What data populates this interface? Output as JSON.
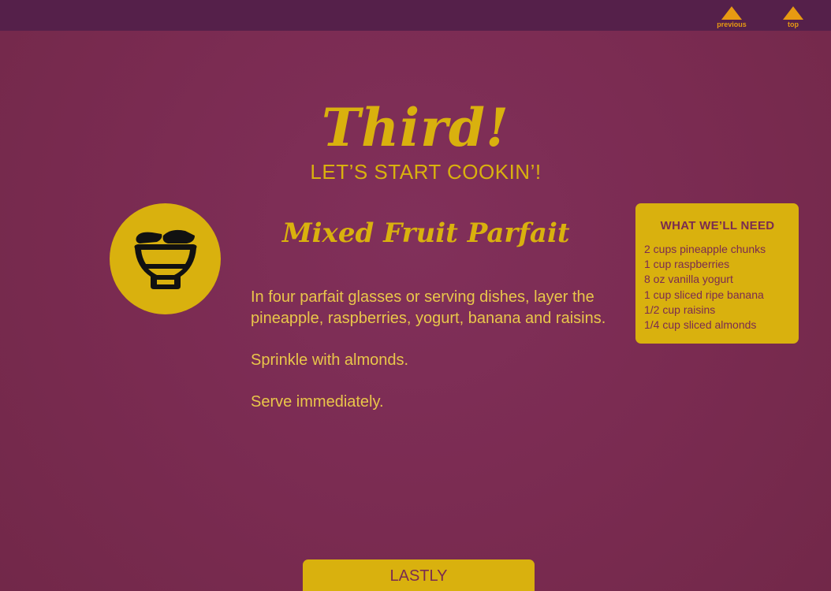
{
  "nav": {
    "previous_label": "previous",
    "top_label": "top"
  },
  "page": {
    "title": "Third!",
    "subtitle": "LET’S START COOKIN’!"
  },
  "recipe": {
    "title": "Mixed Fruit Parfait",
    "steps": [
      "In four parfait glasses or serving dishes, layer the pineapple, raspberries, yogurt, banana and raisins.",
      "Sprinkle with almonds.",
      "Serve immediately."
    ]
  },
  "ingredients": {
    "heading": "WHAT WE’LL NEED",
    "items": [
      "2 cups pineapple chunks",
      "1 cup  raspberries",
      "8 oz vanilla yogurt",
      "1 cup sliced ripe banana",
      "1/2 cup raisins",
      "1/4 cup sliced almonds"
    ]
  },
  "footer": {
    "next_label": "LASTLY"
  },
  "icons": {
    "nav_arrow": "triangle-up-icon",
    "recipe": "parfait-bowl-icon"
  },
  "colors": {
    "background": "#7a2b51",
    "topbar": "#55204a",
    "accent_gold": "#d9b10e",
    "nav_orange": "#e79a12"
  }
}
